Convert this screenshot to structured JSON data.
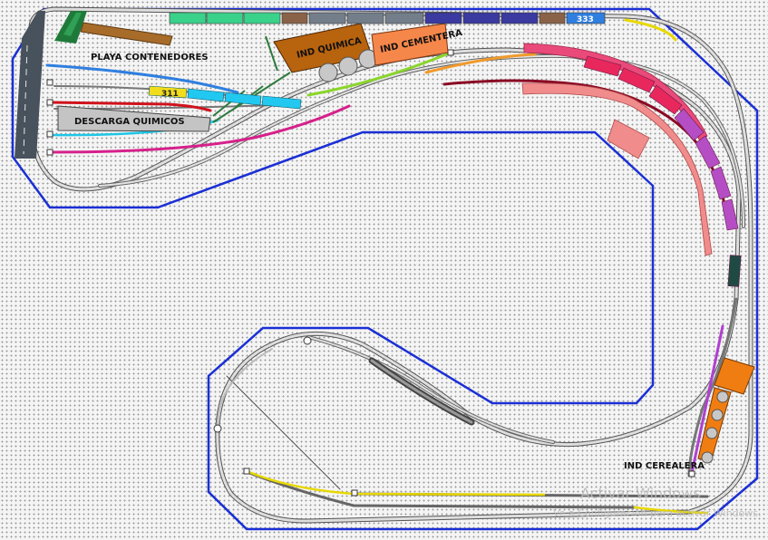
{
  "labels": {
    "playa_contenedores": "PLAYA CONTENEDORES",
    "descarga_quimicos": "DESCARGA QUIMICOS",
    "ind_quimica": "IND QUIMICA",
    "ind_cementera": "IND CEMENTERA",
    "ind_cerealera": "IND CEREALERA",
    "loco_311": "311",
    "loco_333": "333"
  },
  "watermark": {
    "line1": "Activar Windows",
    "line2": "Ve a Configuración para activar Windows."
  },
  "colors": {
    "baseboard_border": "#1a2fd6",
    "track_main": "#888888",
    "track_edge": "#555555",
    "background": "#f4f4f4",
    "tracks": {
      "blue": "#2f7fe0",
      "cyan": "#1fc6e6",
      "red": "#d0121c",
      "magenta": "#d6208a",
      "yellow": "#e8d800",
      "green": "#8ad62a",
      "orange": "#f19a2a",
      "maroon": "#8a0a24",
      "purple": "#b040d0"
    },
    "industry_quimica": "#b8630e",
    "industry_cementera": "#f6874a",
    "industry_cerealera": "#f07d12",
    "platform_descarga": "#c4c4c4",
    "platforms_salmon": "#f08c8c"
  }
}
